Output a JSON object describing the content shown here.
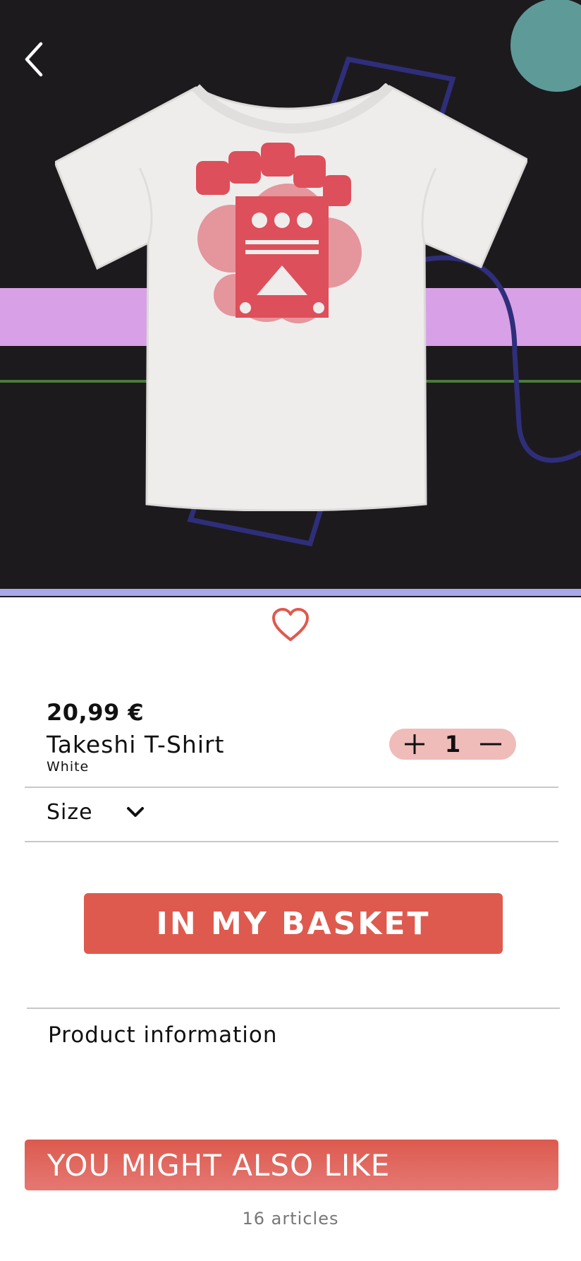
{
  "product": {
    "price": "20,99 €",
    "name": "Takeshi T-Shirt",
    "color": "White",
    "quantity": "1",
    "size_label": "Size",
    "basket_label": "IN MY BASKET",
    "info_label": "Product information",
    "image_alt": "White t-shirt with red print"
  },
  "recommendations": {
    "title": "YOU MIGHT ALSO LIKE",
    "count_text": "16 articles"
  },
  "icons": {
    "back": "chevron-left-icon",
    "wishlist": "heart-outline-icon",
    "increment": "plus-icon",
    "decrement": "minus-icon",
    "size_dropdown": "chevron-down-icon"
  },
  "colors": {
    "accent": "#de5a4e",
    "stepper_bg": "#efbcb9",
    "hero_bg": "#1c1a1d",
    "stripe_violet": "#d8a0e6",
    "shape_blue": "#2f2e7a",
    "circle_teal": "#5e9a98",
    "print_red": "#dd4f5b"
  }
}
